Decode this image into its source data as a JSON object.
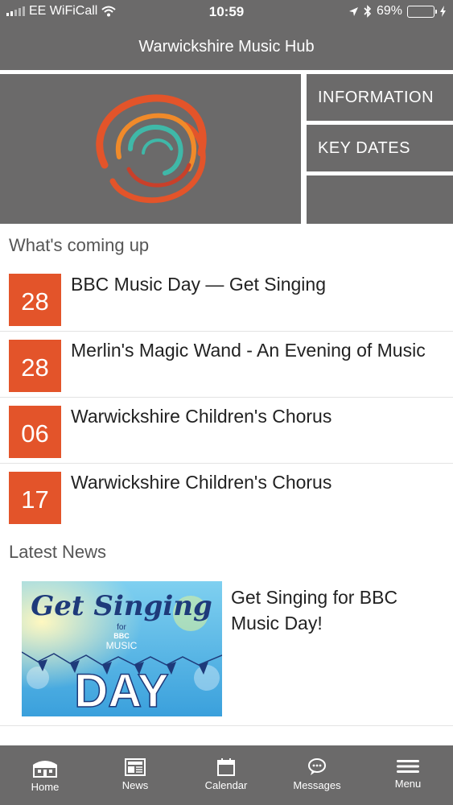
{
  "status_bar": {
    "carrier": "EE WiFiCall",
    "time": "10:59",
    "battery": "69%",
    "battery_level": 0.69
  },
  "header": {
    "title": "Warwickshire Music Hub"
  },
  "hero": {
    "logo_icon": "swirl-logo",
    "buttons": [
      {
        "label": "INFORMATION"
      },
      {
        "label": "KEY DATES"
      },
      {
        "label": ""
      }
    ]
  },
  "upcoming": {
    "title": "What's coming up",
    "events": [
      {
        "day": "28",
        "title": "BBC Music Day — Get Singing"
      },
      {
        "day": "28",
        "title": "Merlin's Magic Wand - An Evening of Music"
      },
      {
        "day": "06",
        "title": "Warwickshire Children's Chorus"
      },
      {
        "day": "17",
        "title": "Warwickshire Children's Chorus"
      }
    ]
  },
  "news": {
    "title": "Latest News",
    "items": [
      {
        "title": "Get Singing for BBC Music Day!",
        "image_text": {
          "line1": "Get Singing",
          "for": "for",
          "bbc": "BBC",
          "music": "MUSIC",
          "day": "DAY"
        }
      }
    ]
  },
  "tabbar": {
    "tabs": [
      {
        "label": "Home",
        "icon": "home-icon"
      },
      {
        "label": "News",
        "icon": "news-icon"
      },
      {
        "label": "Calendar",
        "icon": "calendar-icon"
      },
      {
        "label": "Messages",
        "icon": "messages-icon"
      },
      {
        "label": "Menu",
        "icon": "menu-icon"
      }
    ]
  },
  "colors": {
    "bar_grey": "#6b6a6a",
    "accent_orange": "#e3542a",
    "battery_green": "#4cd964"
  }
}
